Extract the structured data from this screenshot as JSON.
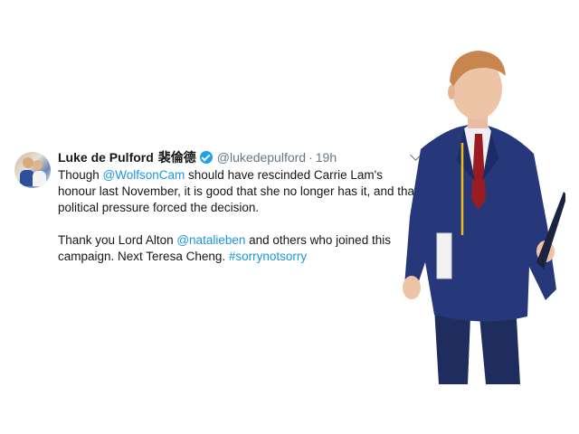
{
  "tweet": {
    "name": "Luke de Pulford",
    "name_chinese": "裴倫德",
    "handle": "@lukedepulford",
    "separator": "·",
    "time": "19h",
    "para1": {
      "t1": "Though ",
      "mention1": "@WolfsonCam",
      "t2": " should have rescinded Carrie Lam's honour last November, it is good that she no longer has it, and that political pressure forced the decision."
    },
    "para2": {
      "t1": "Thank you Lord Alton ",
      "mention1": "@natalieben",
      "t2": " and others who joined this campaign. Next Teresa Cheng. ",
      "hashtag": "#sorrynotsorry"
    }
  },
  "icons": {
    "verified": "verified-badge-icon",
    "menu": "chevron-down-icon"
  },
  "colors": {
    "link": "#1b95e0",
    "text": "#14171a",
    "muted": "#657786",
    "verified": "#1da1f2",
    "suit": "#24356f"
  }
}
